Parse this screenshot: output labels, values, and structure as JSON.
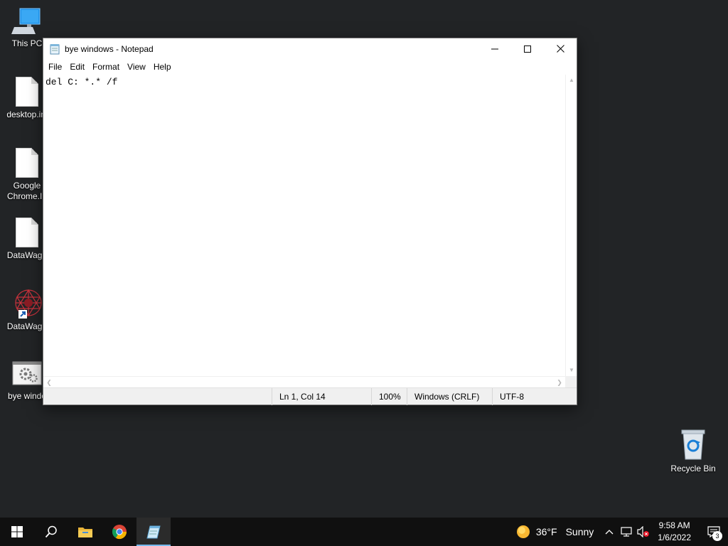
{
  "desktop": {
    "icons": [
      {
        "label": "This PC",
        "icon": "computer-icon"
      },
      {
        "label": "desktop.ini",
        "icon": "file-icon"
      },
      {
        "label": "Google\nChrome.In",
        "icon": "file-icon"
      },
      {
        "label": "DataWago",
        "icon": "file-icon"
      },
      {
        "label": "DataWago",
        "icon": "datawagon-shortcut-icon"
      },
      {
        "label": "bye windo",
        "icon": "batch-file-icon"
      }
    ],
    "recycle_bin": {
      "label": "Recycle Bin",
      "icon": "recycle-bin-icon"
    }
  },
  "notepad": {
    "title": "bye windows - Notepad",
    "menu": [
      "File",
      "Edit",
      "Format",
      "View",
      "Help"
    ],
    "content": "del C: *.* /f",
    "status": {
      "position": "Ln 1, Col 14",
      "zoom": "100%",
      "line_ending": "Windows (CRLF)",
      "encoding": "UTF-8"
    }
  },
  "taskbar": {
    "apps": [
      "windows-start-icon",
      "search-icon",
      "file-explorer-icon",
      "chrome-icon",
      "notepad-icon"
    ],
    "active_app": "notepad-icon",
    "weather": {
      "temp": "36°F",
      "condition": "Sunny",
      "icon": "sun-icon"
    },
    "clock": {
      "time": "9:58 AM",
      "date": "1/6/2022"
    },
    "notification_count": "3"
  },
  "colors": {
    "desktop_bg": "#222426",
    "taskbar_bg": "#101010",
    "accent": "#76b9ed"
  }
}
